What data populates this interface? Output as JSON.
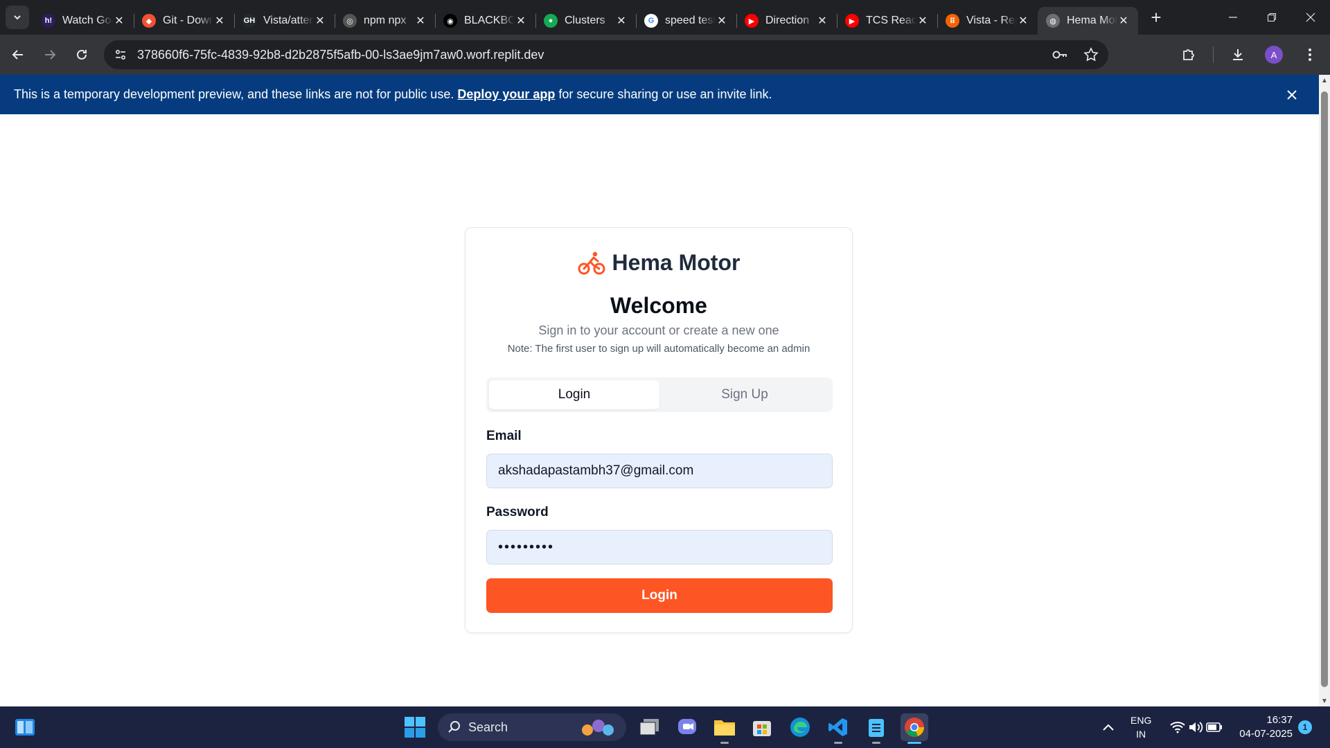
{
  "browser": {
    "tabs": [
      {
        "title": "Watch Good Movies",
        "favicon": "h!",
        "fav_color": "#2c1d5c"
      },
      {
        "title": "Git - Downloads",
        "favicon": "◆",
        "fav_color": "#f05133"
      },
      {
        "title": "Vista/attendance",
        "favicon": "GH",
        "fav_color": "#24292f"
      },
      {
        "title": "npm npx",
        "favicon": "◎",
        "fav_color": "#555"
      },
      {
        "title": "BLACKBOX",
        "favicon": "◉",
        "fav_color": "#000"
      },
      {
        "title": "Clusters",
        "favicon": "●",
        "fav_color": "#13aa52"
      },
      {
        "title": "speed test",
        "favicon": "G",
        "fav_color": "#fff"
      },
      {
        "title": "Direction",
        "favicon": "▶",
        "fav_color": "#ff0000"
      },
      {
        "title": "TCS Ready",
        "favicon": "▶",
        "fav_color": "#ff0000"
      },
      {
        "title": "Vista - Replit",
        "favicon": "⠿",
        "fav_color": "#f26207"
      },
      {
        "title": "Hema Motor",
        "favicon": "◍",
        "fav_color": "#6b6f75"
      }
    ],
    "url": "378660f6-75fc-4839-92b8-d2b2875f5afb-00-ls3ae9jm7aw0.worf.replit.dev",
    "profile_initial": "A"
  },
  "banner": {
    "text_before": "This is a temporary development preview, and these links are not for public use.",
    "link": "Deploy your app",
    "text_after": "for secure sharing or use an invite link."
  },
  "page": {
    "brand": "Hema Motor",
    "title": "Welcome",
    "subtitle": "Sign in to your account or create a new one",
    "note": "Note: The first user to sign up will automatically become an admin",
    "tabs": {
      "login": "Login",
      "signup": "Sign Up"
    },
    "email_label": "Email",
    "email_value": "akshadapastambh37@gmail.com",
    "password_label": "Password",
    "password_value": "•••••••••",
    "submit": "Login",
    "accent_color": "#fd5523"
  },
  "taskbar": {
    "search_label": "Search",
    "lang_top": "ENG",
    "lang_bottom": "IN",
    "time": "16:37",
    "date": "04-07-2025",
    "notifications": "1"
  }
}
